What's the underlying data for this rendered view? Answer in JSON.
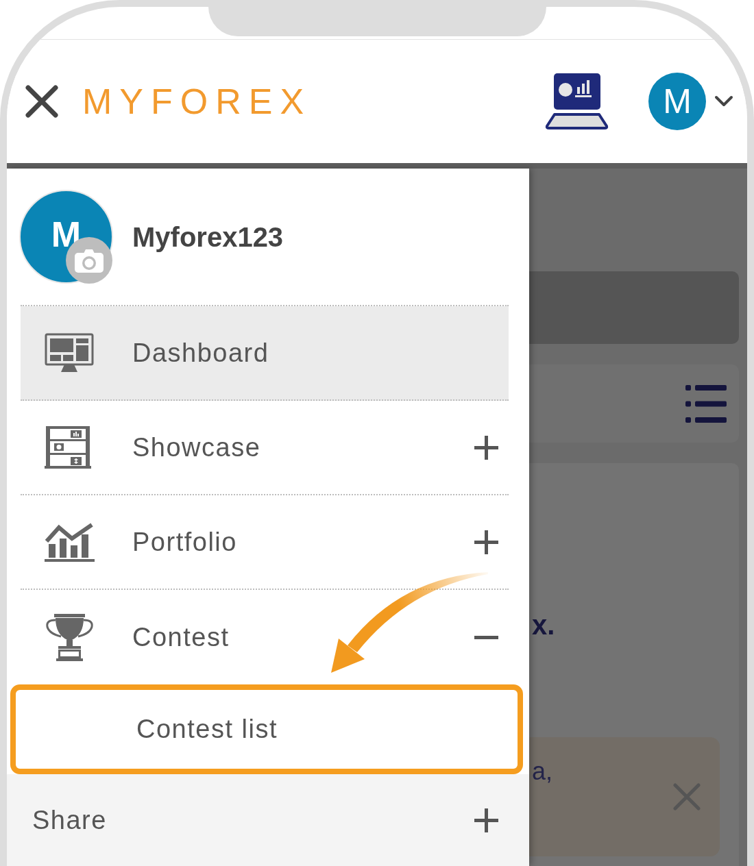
{
  "header": {
    "logo": "MYFOREX",
    "avatar_initial": "M"
  },
  "drawer": {
    "profile": {
      "avatar_initial": "M",
      "username": "Myforex123"
    },
    "menu": [
      {
        "kind": "link",
        "label": "Dashboard",
        "selected": true
      },
      {
        "kind": "group",
        "label": "Showcase",
        "selected": false,
        "expanded": false
      },
      {
        "kind": "group",
        "label": "Portfolio",
        "selected": false,
        "expanded": false
      },
      {
        "kind": "group",
        "label": "Contest",
        "selected": false,
        "expanded": true,
        "children": [
          {
            "label": "Contest list",
            "highlighted": true
          }
        ]
      }
    ],
    "share": {
      "label": "Share",
      "expanded": false
    }
  },
  "background": {
    "card_text": "x.",
    "notice_text": "a,"
  }
}
